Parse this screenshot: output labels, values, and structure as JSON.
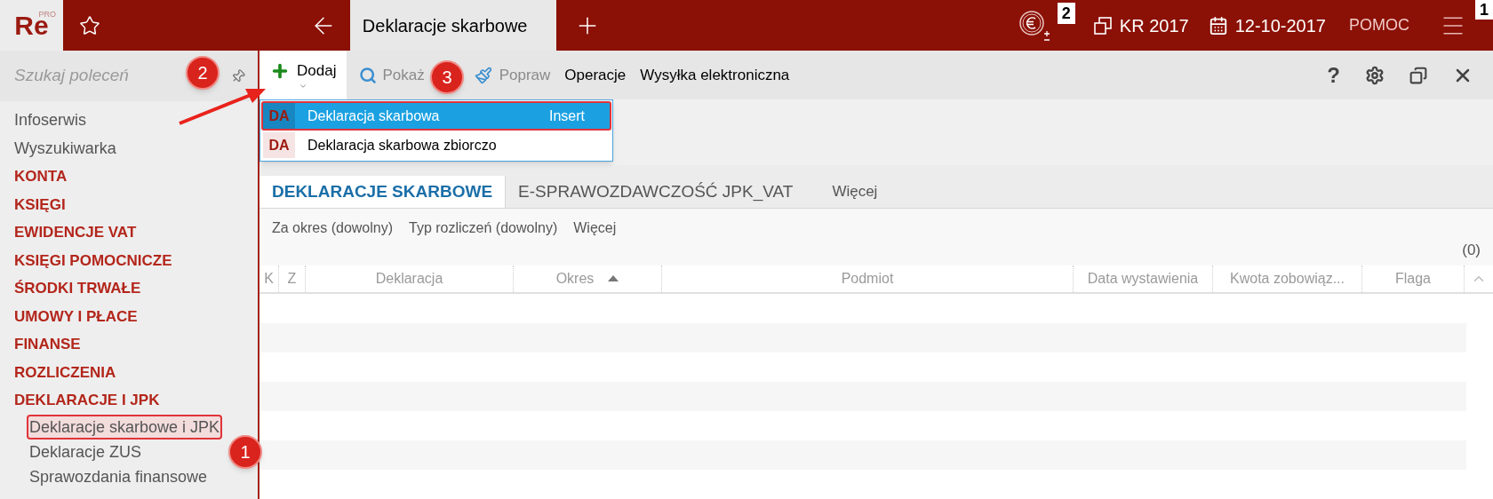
{
  "app": {
    "logo": "Re",
    "logo_sup": "PRO"
  },
  "top_bar": {
    "tab": {
      "label": "Deklaracje skarbowe",
      "selected": true
    },
    "currency_badge": "2",
    "year": "KR 2017",
    "date": "12-10-2017",
    "help": "POMOC",
    "menu_badge": "1"
  },
  "sidebar": {
    "search": {
      "placeholder": "Szukaj poleceń"
    },
    "items": [
      {
        "label": "Infoserwis",
        "kind": "link"
      },
      {
        "label": "Wyszukiwarka",
        "kind": "link"
      },
      {
        "label": "KONTA",
        "kind": "section"
      },
      {
        "label": "KSIĘGI",
        "kind": "section"
      },
      {
        "label": "EWIDENCJE VAT",
        "kind": "section"
      },
      {
        "label": "KSIĘGI POMOCNICZE",
        "kind": "section"
      },
      {
        "label": "ŚRODKI TRWAŁE",
        "kind": "section"
      },
      {
        "label": "UMOWY I PŁACE",
        "kind": "section"
      },
      {
        "label": "FINANSE",
        "kind": "section"
      },
      {
        "label": "ROZLICZENIA",
        "kind": "section"
      },
      {
        "label": "DEKLARACJE I JPK",
        "kind": "section",
        "children": [
          {
            "label": "Deklaracje skarbowe i JPK",
            "selected": true
          },
          {
            "label": "Deklaracje ZUS",
            "selected": false
          },
          {
            "label": "Sprawozdania finansowe",
            "selected": false
          }
        ]
      }
    ]
  },
  "toolbar": {
    "buttons": [
      {
        "label": "Dodaj",
        "kind": "add",
        "disabled": false,
        "expanded": true
      },
      {
        "label": "Pokaż",
        "kind": "show",
        "disabled": true
      },
      {
        "label": "Popraw",
        "kind": "edit",
        "disabled": true
      },
      {
        "label": "Operacje",
        "kind": "text",
        "disabled": false
      },
      {
        "label": "Wysyłka elektroniczna",
        "kind": "text",
        "disabled": false
      }
    ],
    "help": "?"
  },
  "add_menu": [
    {
      "code": "DA",
      "label": "Deklaracja skarbowa",
      "shortcut": "Insert",
      "selected": true
    },
    {
      "code": "DA",
      "label": "Deklaracja skarbowa zbiorczo",
      "selected": false
    }
  ],
  "tabs": [
    {
      "label": "DEKLARACJE SKARBOWE",
      "kind": "main",
      "selected": true
    },
    {
      "label": "E-SPRAWOZDAWCZOŚĆ JPK_VAT",
      "kind": "main",
      "selected": false
    },
    {
      "label": "Więcej",
      "kind": "more",
      "selected": false
    }
  ],
  "filters": [
    "Za okres (dowolny)",
    "Typ rozliczeń (dowolny)",
    "Więcej"
  ],
  "count": "(0)",
  "table": {
    "columns": [
      {
        "label": "K",
        "sorted": false
      },
      {
        "label": "Z",
        "sorted": false
      },
      {
        "label": "Deklaracja",
        "sorted": false
      },
      {
        "label": "Okres",
        "sorted": true
      },
      {
        "label": "Podmiot",
        "sorted": false
      },
      {
        "label": "Data wystawienia",
        "sorted": false
      },
      {
        "label": "Kwota zobowiąz...",
        "sorted": false
      },
      {
        "label": "Flaga",
        "sorted": false
      }
    ]
  },
  "annotations": [
    {
      "label": "1"
    },
    {
      "label": "2"
    },
    {
      "label": "3"
    }
  ]
}
